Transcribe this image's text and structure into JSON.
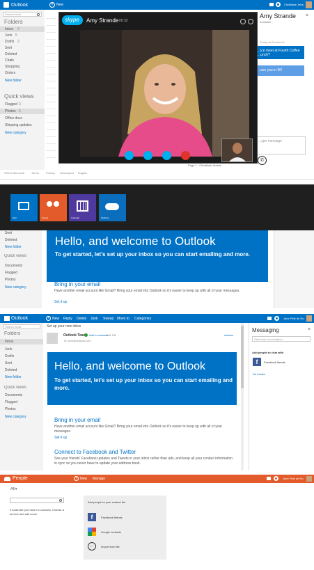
{
  "panel1": {
    "app_title": "Outlook",
    "new_label": "New",
    "user_name": "Christiane Jensen",
    "search_placeholder": "Search email",
    "folders_heading": "Folders",
    "folders": [
      {
        "label": "Inbox",
        "count": "3"
      },
      {
        "label": "Junk",
        "count": "5"
      },
      {
        "label": "Drafts",
        "count": "2"
      },
      {
        "label": "Sent",
        "count": ""
      },
      {
        "label": "Deleted",
        "count": ""
      },
      {
        "label": "Chats",
        "count": ""
      },
      {
        "label": "Shopping",
        "count": ""
      },
      {
        "label": "Orders",
        "count": ""
      }
    ],
    "new_folder": "New folder",
    "quick_views_heading": "Quick views",
    "quick_views": [
      {
        "label": "Flagged",
        "count": "3"
      },
      {
        "label": "Photos",
        "count": "6"
      },
      {
        "label": "Office docs",
        "count": ""
      },
      {
        "label": "Shipping updates",
        "count": ""
      }
    ],
    "new_category": "New category",
    "footer_links": [
      "©2012 Microsoft",
      "Terms",
      "Privacy",
      "Developers",
      "English"
    ],
    "skype": {
      "logo": "skype",
      "caller": "Amy Strande",
      "duration": "00:32"
    },
    "chat": {
      "contact": "Amy Strande",
      "status": "Available",
      "via": "Today via Facebook",
      "bubble1": "...ice meet at Fourth Coffee ...unch?",
      "bubble2": "...see you in 30!",
      "input_placeholder": "...ype message"
    },
    "pager": "Page 1 · Christiane Jensen"
  },
  "panel2": {
    "tiles": [
      {
        "label": "Mail",
        "color": "#0072c6"
      },
      {
        "label": "People",
        "color": "#e35b2b"
      },
      {
        "label": "Calendar",
        "color": "#4e3a9e"
      },
      {
        "label": "SkyDrive",
        "color": "#0a6ebd"
      }
    ],
    "sidebar_items": [
      "Sent",
      "Deleted"
    ],
    "new_folder": "New folder",
    "quick_views_heading": "Quick views",
    "quick_views": [
      "Documents",
      "Flagged",
      "Photos"
    ],
    "new_category": "New category",
    "banner_title": "Hello, and welcome to Outlook",
    "banner_subtitle": "To get started, let's set up your inbox so you can start emailing and more.",
    "section_title": "Bring in your email",
    "section_text": "Have another email account like Gmail? Bring your email into Outlook so it's easier to keep up with all of your messages.",
    "section_link": "Set it up"
  },
  "panel3": {
    "app_title": "Outlook",
    "user_name": "Jane Fête de Rozé",
    "commands": [
      "New",
      "Reply",
      "Delete",
      "Junk",
      "Sweep",
      "Move to",
      "Categories"
    ],
    "search_placeholder": "Search email",
    "folders_heading": "Folders",
    "folders": [
      "Inbox",
      "Junk",
      "Drafts",
      "Sent",
      "Deleted"
    ],
    "new_folder": "New folder",
    "quick_views_heading": "Quick views",
    "quick_views": [
      "Documents",
      "Flagged",
      "Photos"
    ],
    "new_category": "New category",
    "subject": "Set up your new inbox",
    "sender": "Outlook Team",
    "sender_tag": "Add to contacts",
    "sender_time": "6:32 PM",
    "sender_email": "To: jane@outlook.com",
    "actions_label": "Actions",
    "banner_title": "Hello, and welcome to Outlook",
    "banner_subtitle": "To get started, let's set up your inbox so you can start emailing and more.",
    "section1_title": "Bring in your email",
    "section1_text": "Have another email account like Gmail? Bring your email into Outlook so it's easier to keep up with all of your messages.",
    "section1_link": "Set it up",
    "section2_title": "Connect to Facebook and Twitter",
    "section2_text": "See your friends' Facebook updates and Tweets in your inbox rather than ads, and keep all your contact information in sync so you never have to update your address book.",
    "messaging": {
      "title": "Messaging",
      "input_placeholder": "Start new conversation",
      "add_people": "Add people to chat with",
      "facebook": "Facebook friends",
      "no_thanks": "No thanks"
    }
  },
  "panel4": {
    "app_title": "People",
    "new_label": "New",
    "manage_label": "Manage",
    "user_name": "Jane Fête de Rozé",
    "filter_label": "All",
    "empty_text": "It looks like you have no contacts. Choose a service and add some.",
    "add_heading": "Add people to your contact list",
    "sources": [
      {
        "label": "Facebook friends",
        "icon": "facebook-icon"
      },
      {
        "label": "Google contacts",
        "icon": "google-icon"
      },
      {
        "label": "Import from file",
        "icon": "import-icon"
      }
    ]
  },
  "colors": {
    "outlook_blue": "#0072c6",
    "people_orange": "#e35b2b",
    "link_blue": "#0072c6"
  }
}
